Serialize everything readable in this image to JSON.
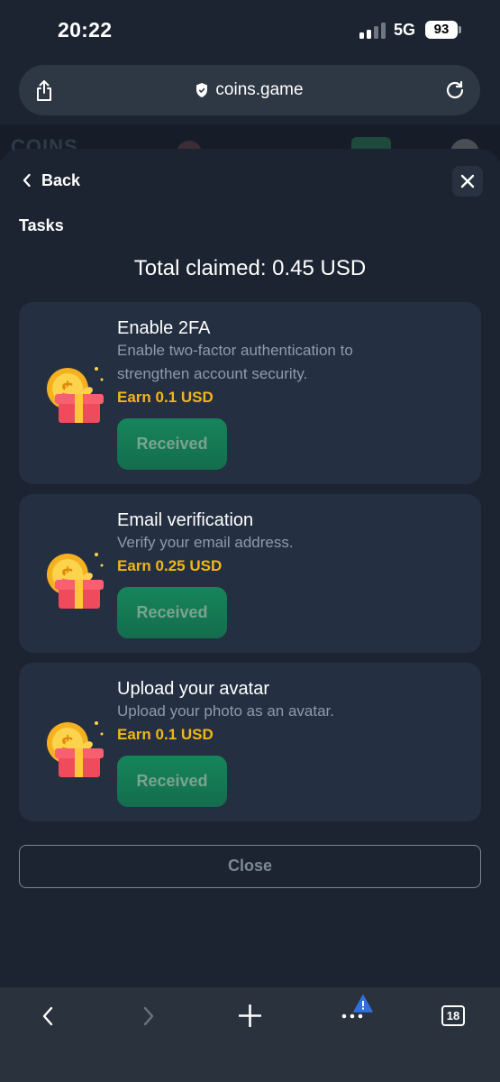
{
  "status_bar": {
    "time": "20:22",
    "network": "5G",
    "battery": "93"
  },
  "browser": {
    "url": "coins.game"
  },
  "background_site": {
    "logo": "COINS"
  },
  "sheet": {
    "back_label": "Back",
    "section_title": "Tasks",
    "total_claimed": "Total claimed: 0.45 USD",
    "tasks": [
      {
        "title": "Enable 2FA",
        "description": "Enable two-factor authentication to strengthen account security.",
        "reward": "Earn 0.1 USD",
        "button_label": "Received"
      },
      {
        "title": "Email verification",
        "description": "Verify your email address.",
        "reward": "Earn 0.25 USD",
        "button_label": "Received"
      },
      {
        "title": "Upload your avatar",
        "description": "Upload your photo as an avatar.",
        "reward": "Earn 0.1 USD",
        "button_label": "Received"
      }
    ],
    "close_label": "Close"
  },
  "bottom_bar": {
    "tab_count": "18"
  },
  "colors": {
    "background": "#1c2431",
    "card": "#243041",
    "reward": "#f3b617",
    "received_button": "#16855b",
    "description": "#8f9aab"
  },
  "icons": [
    "share-icon",
    "shield-icon",
    "reload-icon",
    "chevron-left-icon",
    "close-icon",
    "gift-coin-icon",
    "chevron-right-icon",
    "plus-icon",
    "more-icon",
    "alert-icon",
    "tabs-icon"
  ]
}
